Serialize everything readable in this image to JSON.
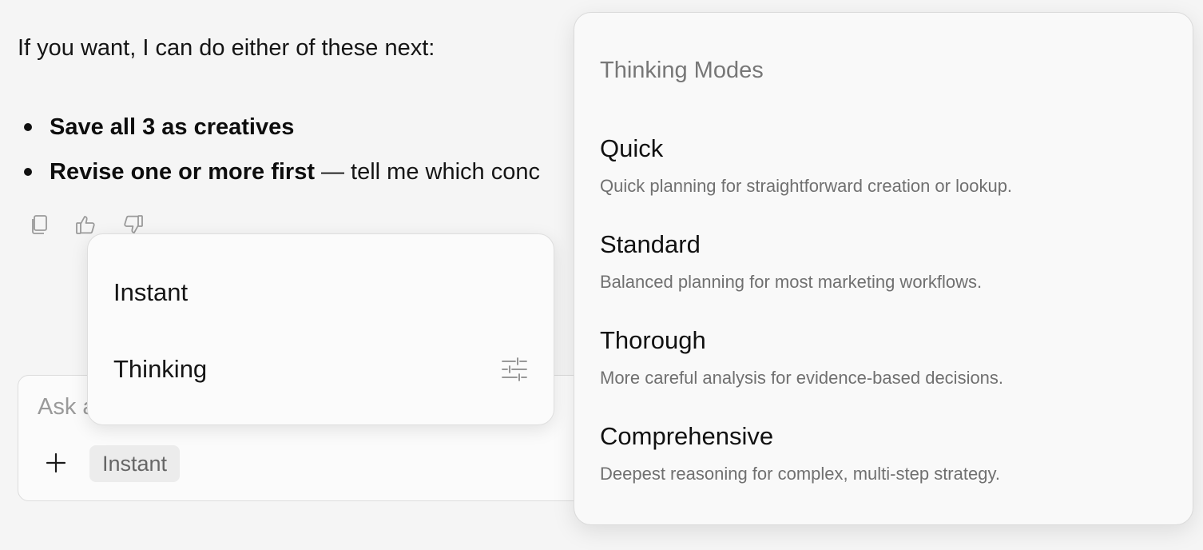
{
  "chat": {
    "intro": "If you want, I can do either of these next:",
    "bullets": [
      {
        "bold": "Save all 3 as creatives",
        "rest": ""
      },
      {
        "bold": "Revise one or more first",
        "rest": "— tell me which conc"
      }
    ],
    "actions": [
      {
        "icon": "copy-icon"
      },
      {
        "icon": "thumbs-up-icon"
      },
      {
        "icon": "thumbs-down-icon"
      }
    ]
  },
  "composer": {
    "placeholder": "Ask a",
    "plus_icon": "plus-icon",
    "mode_chip": "Instant"
  },
  "mode_menu": {
    "items": [
      {
        "label": "Instant"
      },
      {
        "label": "Thinking",
        "icon": "tune-sliders-icon"
      }
    ]
  },
  "thinking_panel": {
    "title": "Thinking Modes",
    "options": [
      {
        "name": "Quick",
        "description": "Quick planning for straightforward creation or lookup."
      },
      {
        "name": "Standard",
        "description": "Balanced planning for most marketing workflows."
      },
      {
        "name": "Thorough",
        "description": "More careful analysis for evidence-based decisions."
      },
      {
        "name": "Comprehensive",
        "description": "Deepest reasoning for complex, multi-step strategy."
      }
    ]
  }
}
